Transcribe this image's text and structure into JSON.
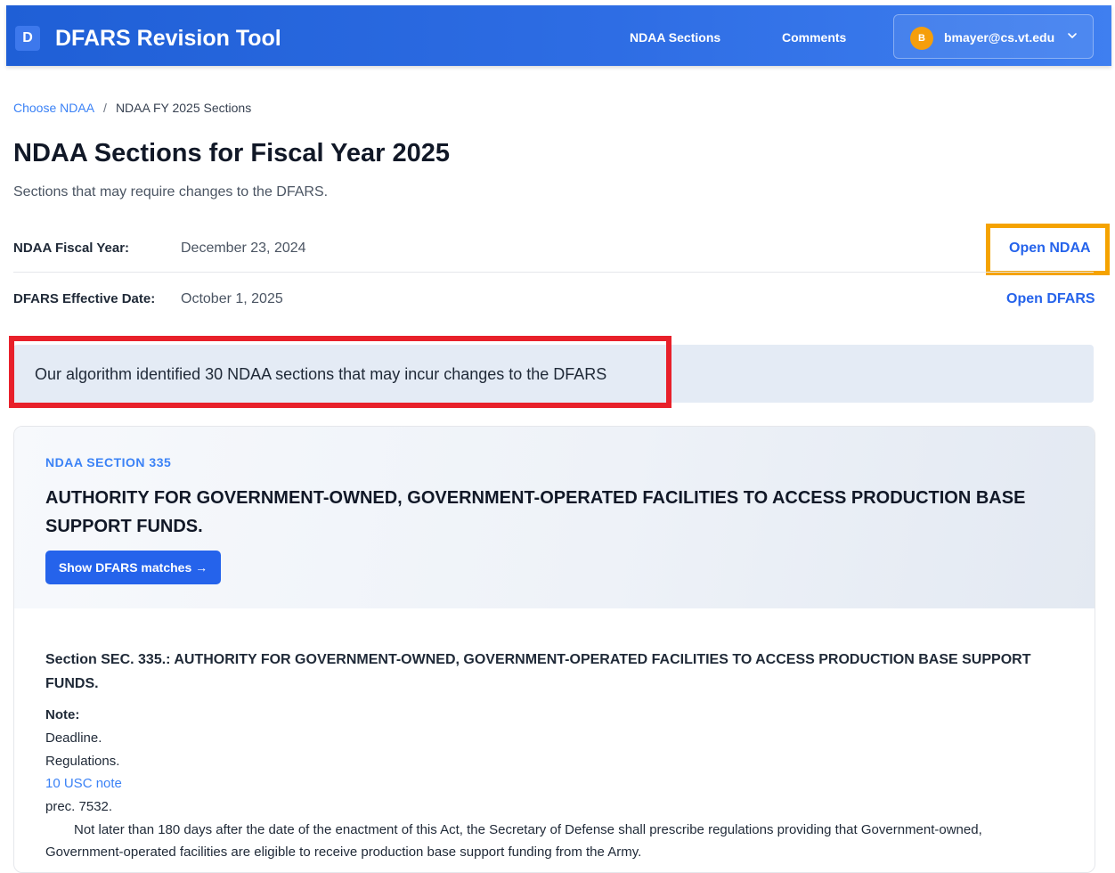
{
  "header": {
    "logo_letter": "D",
    "app_title": "DFARS Revision Tool",
    "nav": [
      "NDAA Sections",
      "Comments"
    ],
    "user": {
      "initial": "B",
      "email": "bmayer@cs.vt.edu"
    }
  },
  "breadcrumb": {
    "root": "Choose NDAA",
    "separator": "/",
    "current": "NDAA FY 2025 Sections"
  },
  "page": {
    "title": "NDAA Sections for Fiscal Year 2025",
    "subtitle": "Sections that may require changes to the DFARS."
  },
  "info": {
    "fiscal_year_label": "NDAA Fiscal Year:",
    "fiscal_year_value": "December 23, 2024",
    "open_ndaa": "Open NDAA",
    "effective_label": "DFARS Effective Date:",
    "effective_value": "October 1, 2025",
    "open_dfars": "Open DFARS"
  },
  "alert": {
    "text": "Our algorithm identified 30 NDAA sections that may incur changes to the DFARS"
  },
  "section": {
    "eyebrow": "NDAA SECTION 335",
    "title": "AUTHORITY FOR GOVERNMENT-OWNED, GOVERNMENT-OPERATED FACILITIES TO ACCESS PRODUCTION BASE SUPPORT FUNDS.",
    "button": "Show DFARS matches →",
    "body_heading": "Section SEC. 335.: AUTHORITY FOR GOVERNMENT-OWNED, GOVERNMENT-OPERATED FACILITIES TO ACCESS PRODUCTION BASE SUPPORT FUNDS.",
    "note_label": "Note:",
    "note_lines": [
      "Deadline.",
      "Regulations."
    ],
    "usc_link": "10 USC note",
    "prec": "prec. 7532.",
    "paragraph": "Not later than 180 days after the date of the enactment of this Act, the Secretary of Defense shall prescribe regulations providing that Government-owned, Government-operated facilities are eligible to receive production base support funding from the Army."
  },
  "colors": {
    "header_blue": "#2563eb",
    "link_blue": "#3b82f6",
    "highlight_orange": "#f5a300",
    "highlight_red": "#e8202a",
    "avatar_orange": "#f59e0b"
  }
}
